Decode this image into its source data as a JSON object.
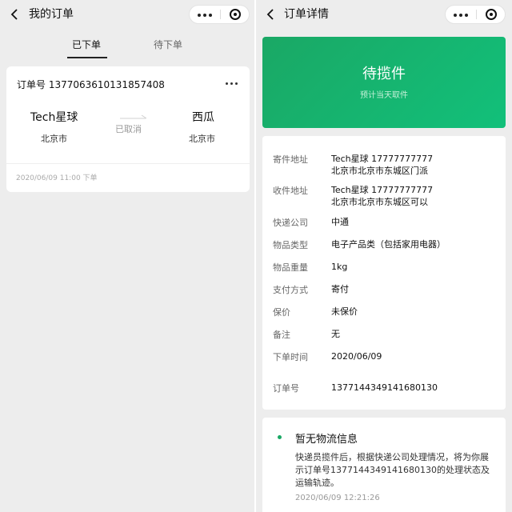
{
  "left": {
    "title": "我的订单",
    "tabs": [
      {
        "label": "已下单",
        "active": true
      },
      {
        "label": "待下单",
        "active": false
      }
    ],
    "order": {
      "order_no": "订单号 1377063610131857408",
      "from_name": "Tech星球",
      "from_city": "北京市",
      "to_name": "西瓜",
      "to_city": "北京市",
      "status": "已取消",
      "time": "2020/06/09 11:00 下单"
    }
  },
  "right": {
    "title": "订单详情",
    "banner": {
      "title": "待揽件",
      "subtitle": "预计当天取件"
    },
    "details": [
      {
        "label": "寄件地址",
        "value": "Tech星球 17777777777",
        "value2": "北京市北京市东城区门派"
      },
      {
        "label": "收件地址",
        "value": "Tech星球 17777777777",
        "value2": "北京市北京市东城区可以"
      },
      {
        "label": "快递公司",
        "value": "中通"
      },
      {
        "label": "物品类型",
        "value": "电子产品类（包括家用电器）"
      },
      {
        "label": "物品重量",
        "value": "1kg"
      },
      {
        "label": "支付方式",
        "value": "寄付"
      },
      {
        "label": "保价",
        "value": "未保价"
      },
      {
        "label": "备注",
        "value": "无"
      },
      {
        "label": "下单时间",
        "value": "2020/06/09"
      },
      {
        "label": "订单号",
        "value": "1377144349141680130"
      }
    ],
    "logistics": {
      "title": "暂无物流信息",
      "desc": "快递员揽件后，根据快递公司处理情况，将为你展示订单号1377144349141680130的处理状态及运输轨迹。",
      "time": "2020/06/09 12:21:26"
    }
  },
  "colors": {
    "accent": "#1aa865",
    "background": "#ededed",
    "card": "#ffffff"
  }
}
